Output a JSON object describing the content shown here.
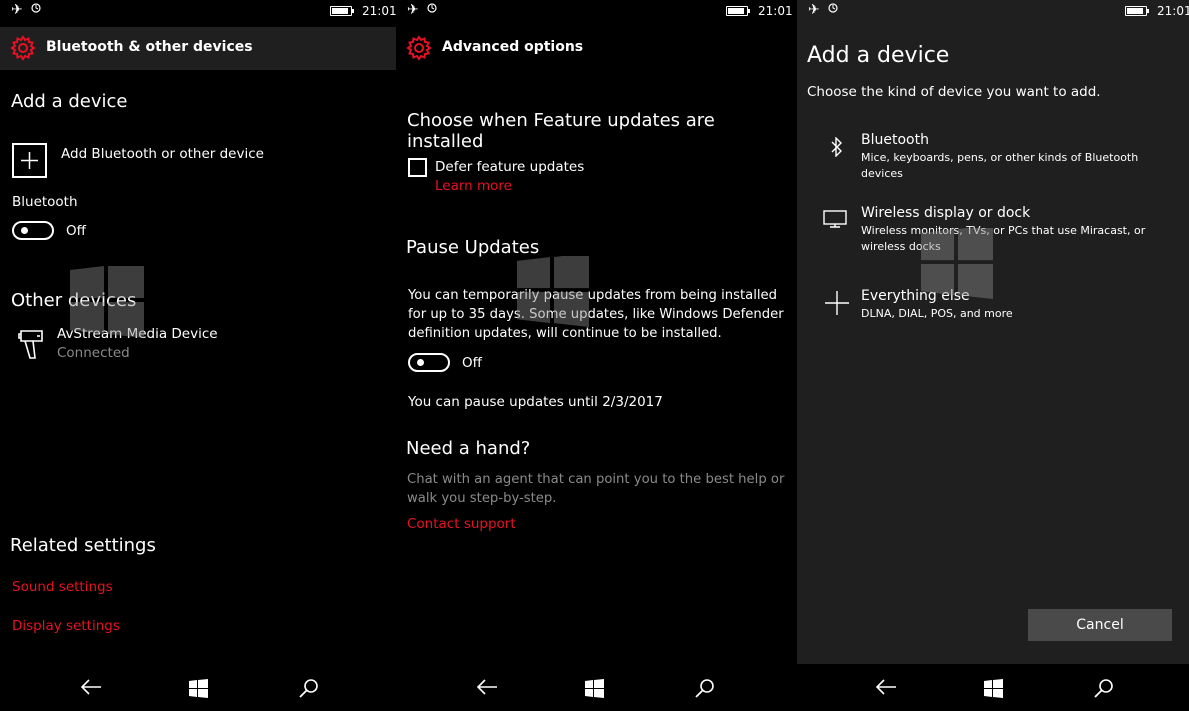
{
  "status_bar": {
    "time": "21:01"
  },
  "screen1": {
    "title": "Bluetooth & other devices",
    "add_device_heading": "Add a device",
    "add_device_label": "Add Bluetooth or other device",
    "bluetooth_label": "Bluetooth",
    "bluetooth_toggle_state": "Off",
    "other_devices_heading": "Other devices",
    "device_name": "AvStream Media Device",
    "device_status": "Connected",
    "related_heading": "Related settings",
    "sound_settings_link": "Sound settings",
    "display_settings_link": "Display settings"
  },
  "screen2": {
    "title": "Advanced options",
    "feature_heading": "Choose when Feature updates are installed",
    "defer_label": "Defer feature updates",
    "learn_more_link": "Learn more",
    "pause_heading": "Pause Updates",
    "pause_description_lines": [
      "You can temporarily pause updates from being installed",
      "for up to 35 days. Some updates, like Windows Defender",
      "definition updates, will continue to be installed."
    ],
    "pause_toggle_state": "Off",
    "pause_until_text": "You can pause updates until 2/3/2017",
    "help_heading": "Need a hand?",
    "help_description_lines": [
      "Chat with an agent that can point you to the best help or",
      "walk you step-by-step."
    ],
    "contact_support_link": "Contact support"
  },
  "screen3": {
    "title": "Add a device",
    "subtitle": "Choose the kind of device you want to add.",
    "options": [
      {
        "icon": "bluetooth-icon",
        "title": "Bluetooth",
        "description": [
          "Mice, keyboards, pens, or other kinds of Bluetooth devices"
        ]
      },
      {
        "icon": "monitor-icon",
        "title": "Wireless display or dock",
        "description": [
          "Wireless monitors, TVs, or PCs that use Miracast, or",
          "wireless docks"
        ]
      },
      {
        "icon": "plus-icon",
        "title": "Everything else",
        "description": [
          "DLNA, DIAL, POS, and more"
        ]
      }
    ],
    "cancel_label": "Cancel"
  },
  "colors": {
    "accent_red": "#e81123",
    "background": "#000000",
    "panel_gray": "#1f1f1f",
    "button_gray": "#4a4a4a",
    "secondary_text": "#8a8a8a"
  }
}
